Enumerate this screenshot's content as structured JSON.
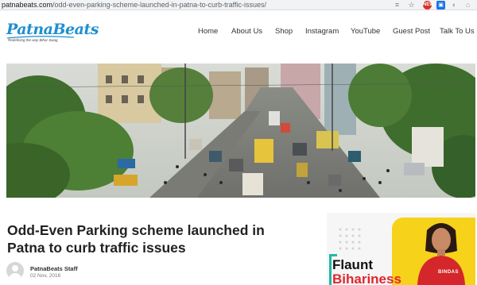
{
  "browser": {
    "url_domain": "patnabeats.com",
    "url_path": "/odd-even-parking-scheme-launched-in-patna-to-curb-traffic-issues/",
    "icons": [
      "qr-code-icon",
      "star-icon",
      "extension-red-icon",
      "extension-blue-icon",
      "extension-grey-icon",
      "extension-check-icon",
      "notification-icon"
    ],
    "ext_badge": "NEW"
  },
  "site": {
    "logo_text": "PatnaBeats",
    "logo_tagline": "Redefining the way Bihar Swag",
    "brand_color": "#1d8fcf"
  },
  "nav": {
    "items": [
      "Home",
      "About Us",
      "Shop",
      "Instagram",
      "YouTube",
      "Guest Post",
      "Talk To Us :)"
    ]
  },
  "article": {
    "title": "Odd-Even Parking scheme launched in Patna to curb traffic issues",
    "author": "PatnaBeats Staff",
    "date": "02 Nov, 2016"
  },
  "ad": {
    "line1": "Flaunt",
    "line2": "Bihariness",
    "tshirt_text": "BINDAS",
    "accent_yellow": "#f6d21b",
    "accent_red": "#e0262c"
  }
}
